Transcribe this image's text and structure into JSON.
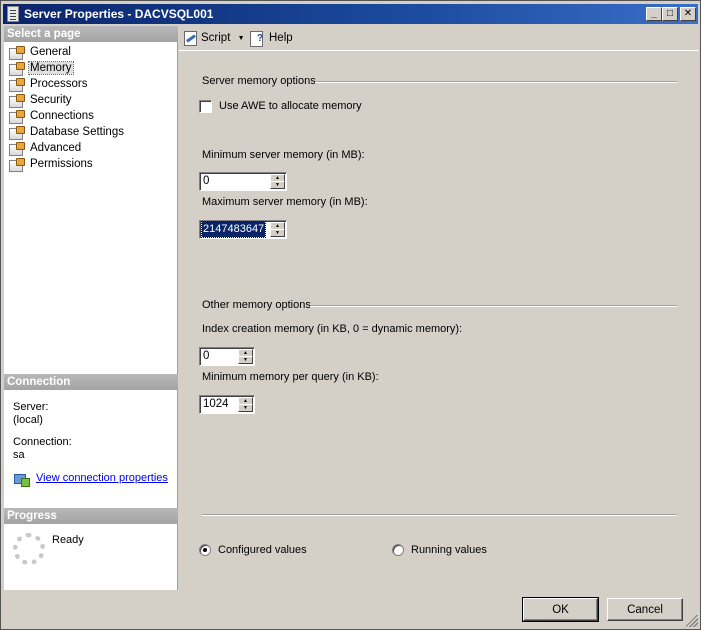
{
  "window": {
    "title": "Server Properties - DACVSQL001",
    "minimize_glyph": "_",
    "maximize_glyph": "□",
    "close_glyph": "✕"
  },
  "left": {
    "select_header": "Select a page",
    "pages": [
      {
        "label": "General"
      },
      {
        "label": "Memory"
      },
      {
        "label": "Processors"
      },
      {
        "label": "Security"
      },
      {
        "label": "Connections"
      },
      {
        "label": "Database Settings"
      },
      {
        "label": "Advanced"
      },
      {
        "label": "Permissions"
      }
    ],
    "selected_page": "Memory",
    "connection_header": "Connection",
    "server_label": "Server:",
    "server_value": "(local)",
    "connection_label": "Connection:",
    "connection_value": "sa",
    "view_link": "View connection properties",
    "progress_header": "Progress",
    "progress_status": "Ready"
  },
  "toolbar": {
    "script_label": "Script",
    "help_label": "Help"
  },
  "memory": {
    "server_group": "Server memory options",
    "awe_label": "Use AWE to allocate memory",
    "awe_checked": false,
    "min_label": "Minimum server memory (in MB):",
    "min_value": "0",
    "max_label": "Maximum server memory (in MB):",
    "max_value": "2147483647",
    "other_group": "Other memory options",
    "index_label": "Index creation memory (in KB, 0 = dynamic memory):",
    "index_value": "0",
    "query_label": "Minimum memory per query (in KB):",
    "query_value": "1024",
    "configured_label": "Configured values",
    "running_label": "Running values",
    "selected_view": "Configured values"
  },
  "buttons": {
    "ok": "OK",
    "cancel": "Cancel"
  }
}
